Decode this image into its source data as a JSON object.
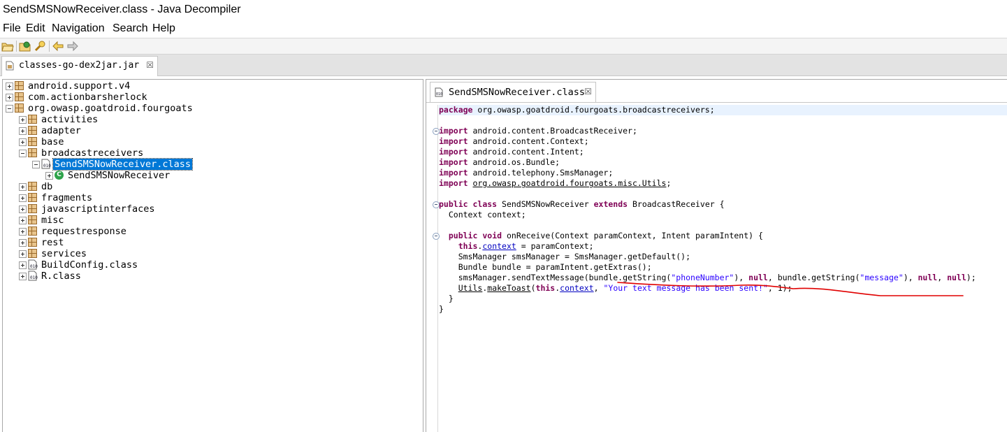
{
  "window": {
    "title": "SendSMSNowReceiver.class - Java Decompiler"
  },
  "menu": {
    "items": [
      "File",
      "Edit",
      "Navigation",
      "Search",
      "Help"
    ]
  },
  "toolbar": {
    "icons": [
      "open-file-icon",
      "open-type-icon",
      "search-icon",
      "back-arrow-icon",
      "forward-arrow-icon"
    ]
  },
  "file_tab": {
    "label": "classes-go-dex2jar.jar",
    "close": "☒"
  },
  "tree": {
    "n0": "android.support.v4",
    "n1": "com.actionbarsherlock",
    "n2": "org.owasp.goatdroid.fourgoats",
    "n3": "activities",
    "n4": "adapter",
    "n5": "base",
    "n6": "broadcastreceivers",
    "n7": "SendSMSNowReceiver.class",
    "n8": "SendSMSNowReceiver",
    "n9": "db",
    "n10": "fragments",
    "n11": "javascriptinterfaces",
    "n12": "misc",
    "n13": "requestresponse",
    "n14": "rest",
    "n15": "services",
    "n16": "BuildConfig.class",
    "n17": "R.class",
    "class_badge": "C"
  },
  "editor": {
    "tab_label": "SendSMSNowReceiver.class",
    "tab_close": "☒",
    "code": {
      "kw_package": "package",
      "package_name": " org.owasp.goatdroid.fourgoats.broadcastreceivers;",
      "kw_import": "import",
      "imp1": " android.content.BroadcastReceiver;",
      "imp2": " android.content.Context;",
      "imp3": " android.content.Intent;",
      "imp4": " android.os.Bundle;",
      "imp5": " android.telephony.SmsManager;",
      "imp6": "org.owasp.goatdroid.fourgoats.misc.Utils",
      "semicolon": ";",
      "space": " ",
      "kw_public": "public",
      "kw_class": "class",
      "class_name": " SendSMSNowReceiver ",
      "kw_extends": "extends",
      "extends_rest": " BroadcastReceiver {",
      "field_decl": "  Context context;",
      "kw_void": "void",
      "method_sig": " onReceive(Context paramContext, Intent paramIntent) {",
      "kw_this": "this",
      "dot": ".",
      "context_field": "context",
      "assign_rest": " = paramContext;",
      "sms_line": "    SmsManager smsManager = SmsManager.getDefault();",
      "bundle_line": "    Bundle bundle = paramIntent.getExtras();",
      "send_pre": "    smsManager.sendTextMessage(bundle.getString(",
      "str_phone": "\"phoneNumber\"",
      "send_mid1": "), ",
      "kw_null": "null",
      "send_mid2": ", bundle.getString(",
      "str_message": "\"message\"",
      "send_mid3": "), ",
      "comma": ", ",
      "send_end": ");",
      "utils": "Utils",
      "make_toast": "makeToast",
      "paren_open": "(",
      "str_toast": "\"Your text message has been sent!\"",
      "toast_end": ", 1);",
      "close_method": "  }",
      "close_class": "}"
    }
  },
  "colors": {
    "keyword": "#7f0055",
    "string": "#2a00ff",
    "field": "#0000c0",
    "selection": "#0078d7",
    "annotation": "#e00000"
  }
}
